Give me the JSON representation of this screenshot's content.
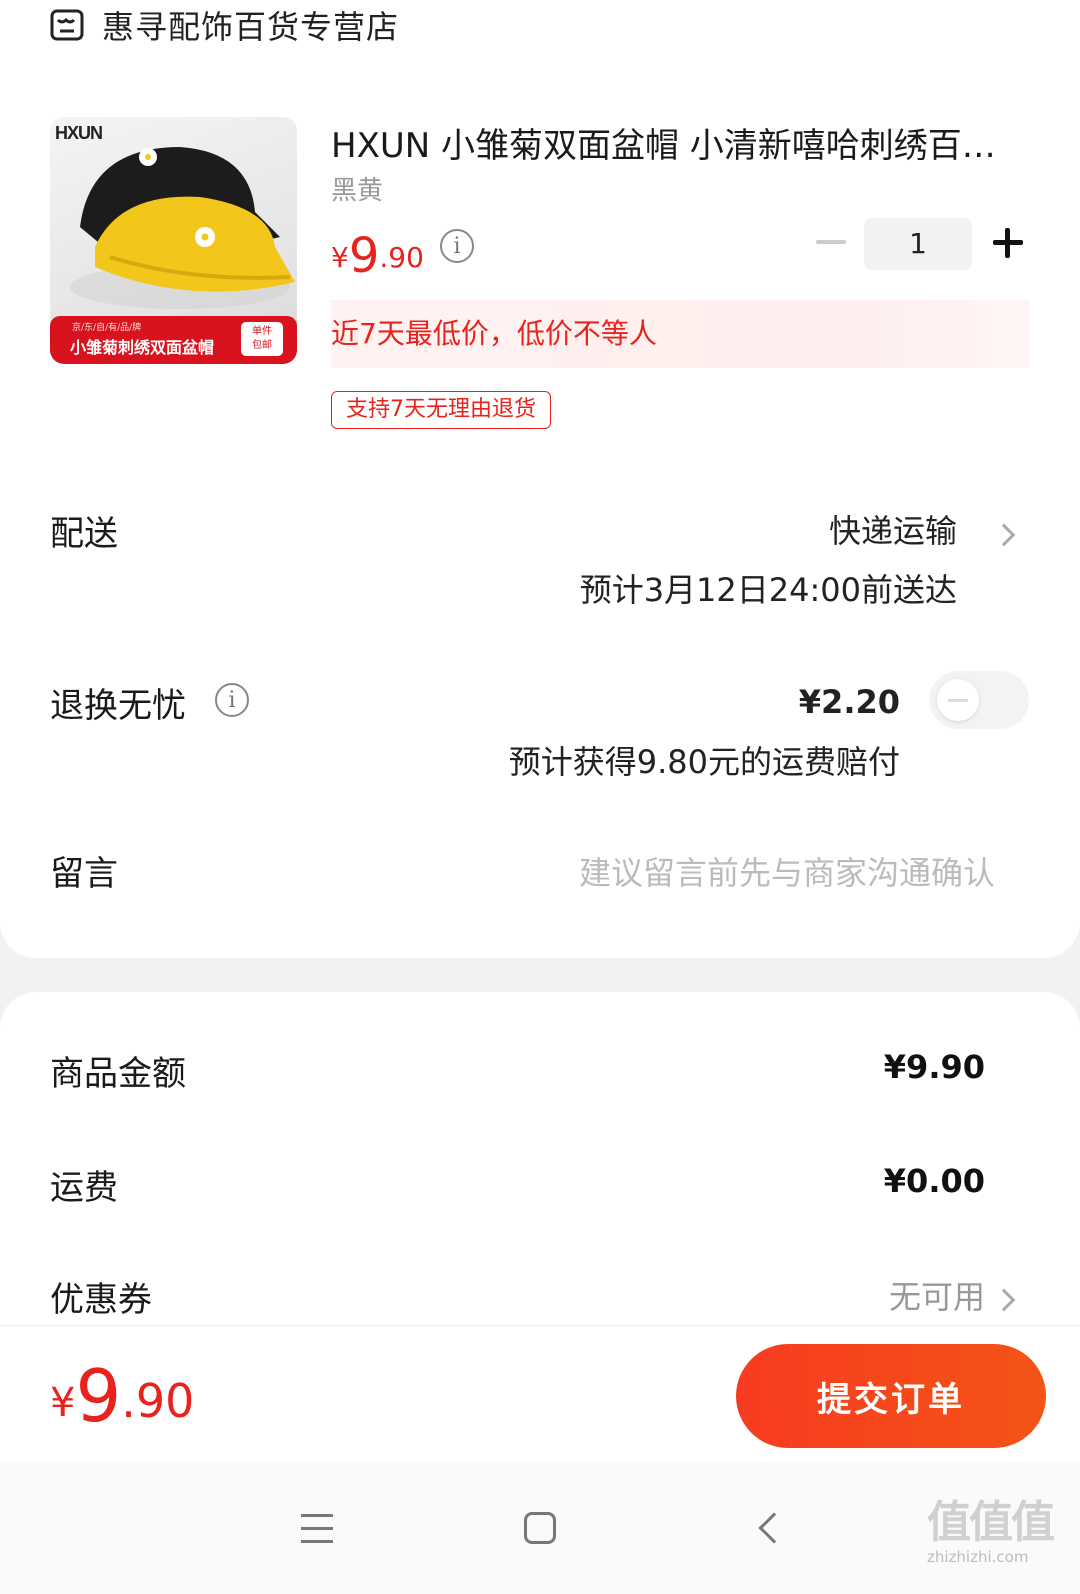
{
  "store": {
    "name": "惠寻配饰百货专营店",
    "icon": "store-icon"
  },
  "product": {
    "image": {
      "logo_text": "HXUN",
      "banner_small": "京/东/自/有/品/牌",
      "banner_title": "小雏菊刺绣双面盆帽",
      "badge_line1": "单件",
      "badge_line2": "包邮"
    },
    "title": "HXUN 小雏菊双面盆帽 小清新嘻哈刺绣百…",
    "variant": "黑黄",
    "price": {
      "symbol": "¥",
      "integer": "9",
      "decimal": ".90"
    },
    "quantity": "1",
    "promo": "近7天最低价，低价不等人",
    "return_tag": "支持7天无理由退货"
  },
  "delivery": {
    "label": "配送",
    "method": "快递运输",
    "eta": "预计3月12日24:00前送达"
  },
  "return_insurance": {
    "label": "退换无忧",
    "price": "¥2.20",
    "desc": "预计获得9.80元的运费赔付",
    "enabled": false
  },
  "message": {
    "label": "留言",
    "placeholder": "建议留言前先与商家沟通确认"
  },
  "summary": {
    "goods_label": "商品金额",
    "goods_value": "¥9.90",
    "shipping_label": "运费",
    "shipping_value": "¥0.00",
    "coupon_label": "优惠券",
    "coupon_value": "无可用"
  },
  "footer": {
    "total": {
      "symbol": "¥",
      "integer": "9",
      "decimal": ".90"
    },
    "submit_label": "提交订单"
  },
  "watermark": {
    "big": "值值值",
    "small": "zhizhizhi.com"
  },
  "colors": {
    "accent": "#e8231d",
    "button": "#f5461a",
    "text": "#1a1a1a",
    "muted": "#999999"
  }
}
